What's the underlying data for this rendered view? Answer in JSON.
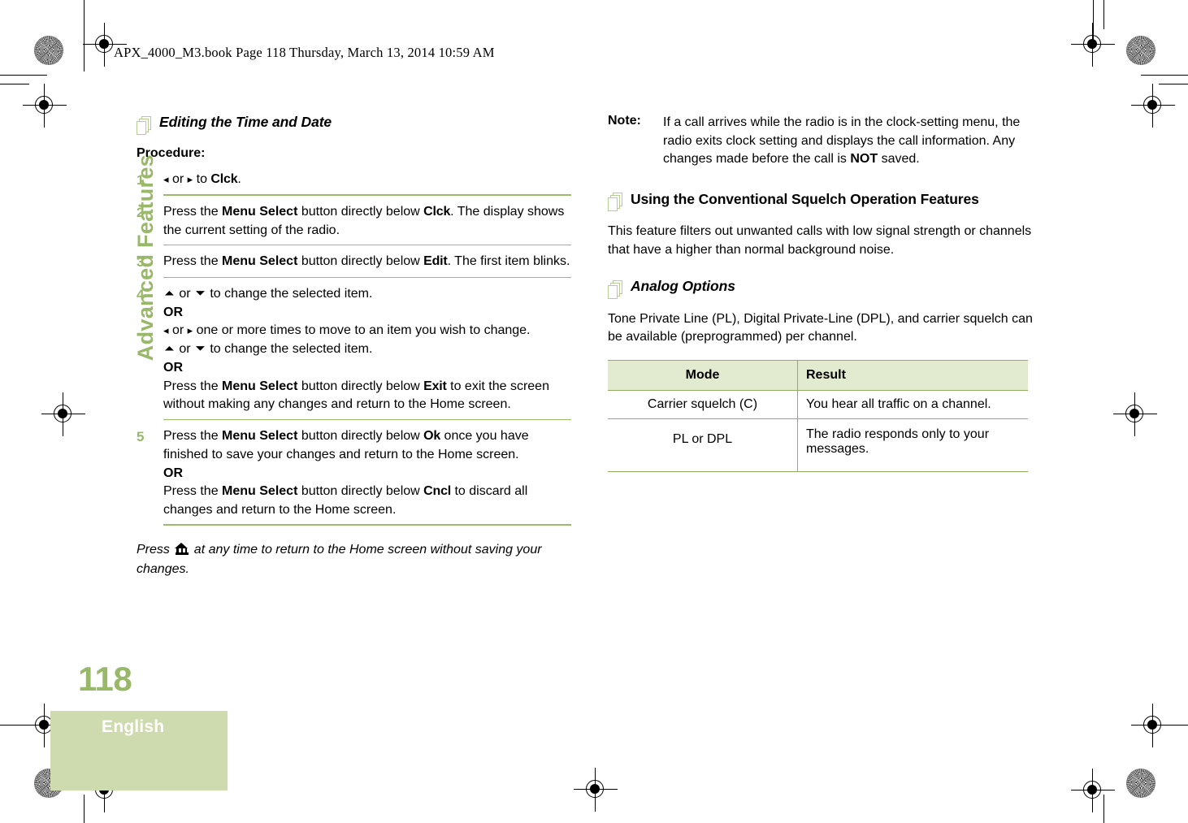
{
  "running_head": "APX_4000_M3.book  Page 118  Thursday, March 13, 2014  10:59 AM",
  "sidebar": {
    "chapter_tab": "Advanced Features",
    "page_number": "118",
    "language": "English"
  },
  "left_column": {
    "section_title": "Editing the Time and Date",
    "procedure_label": "Procedure:",
    "steps": [
      {
        "number": "1",
        "parts": [
          {
            "type": "arrow-left"
          },
          {
            "type": "text",
            "value": " or "
          },
          {
            "type": "arrow-right"
          },
          {
            "type": "text",
            "value": " to "
          },
          {
            "type": "keyword",
            "value": "Clck"
          },
          {
            "type": "text",
            "value": "."
          }
        ]
      },
      {
        "number": "2",
        "parts": [
          {
            "type": "text",
            "value": "Press the "
          },
          {
            "type": "bold",
            "value": "Menu Select"
          },
          {
            "type": "text",
            "value": " button directly below "
          },
          {
            "type": "keyword",
            "value": "Clck"
          },
          {
            "type": "text",
            "value": ". The display shows the current setting of the radio."
          }
        ]
      },
      {
        "number": "3",
        "parts": [
          {
            "type": "text",
            "value": "Press the "
          },
          {
            "type": "bold",
            "value": "Menu Select"
          },
          {
            "type": "text",
            "value": " button directly below "
          },
          {
            "type": "keyword",
            "value": "Edit"
          },
          {
            "type": "text",
            "value": ". The first item blinks."
          }
        ]
      },
      {
        "number": "4",
        "parts": [
          {
            "type": "arrow-up"
          },
          {
            "type": "text",
            "value": " or "
          },
          {
            "type": "arrow-down"
          },
          {
            "type": "text",
            "value": " to change the selected item."
          },
          {
            "type": "break"
          },
          {
            "type": "bold",
            "value": "OR"
          },
          {
            "type": "break"
          },
          {
            "type": "arrow-left"
          },
          {
            "type": "text",
            "value": " or "
          },
          {
            "type": "arrow-right"
          },
          {
            "type": "text",
            "value": " one or more times to move to an item you wish to change."
          },
          {
            "type": "break"
          },
          {
            "type": "arrow-up"
          },
          {
            "type": "text",
            "value": " or "
          },
          {
            "type": "arrow-down"
          },
          {
            "type": "text",
            "value": " to change the selected item."
          },
          {
            "type": "break"
          },
          {
            "type": "bold",
            "value": "OR"
          },
          {
            "type": "break"
          },
          {
            "type": "text",
            "value": "Press the "
          },
          {
            "type": "bold",
            "value": "Menu Select"
          },
          {
            "type": "text",
            "value": " button directly below "
          },
          {
            "type": "keyword",
            "value": "Exit"
          },
          {
            "type": "text",
            "value": " to exit the screen without making any changes and return to the Home screen."
          }
        ]
      },
      {
        "number": "5",
        "parts": [
          {
            "type": "text",
            "value": "Press the "
          },
          {
            "type": "bold",
            "value": "Menu Select"
          },
          {
            "type": "text",
            "value": " button directly below "
          },
          {
            "type": "keyword",
            "value": "Ok"
          },
          {
            "type": "text",
            "value": " once you have finished to save your changes and return to the Home screen."
          },
          {
            "type": "break"
          },
          {
            "type": "bold",
            "value": "OR"
          },
          {
            "type": "break"
          },
          {
            "type": "text",
            "value": "Press the "
          },
          {
            "type": "bold",
            "value": "Menu Select"
          },
          {
            "type": "text",
            "value": " button directly below "
          },
          {
            "type": "keyword",
            "value": "Cncl"
          },
          {
            "type": "text",
            "value": " to discard all changes and return to the Home screen."
          }
        ]
      }
    ],
    "closing_note": {
      "before_icon": "Press ",
      "after_icon": " at any time to return to the Home screen without saving your changes."
    }
  },
  "right_column": {
    "note": {
      "label": "Note:",
      "parts": [
        {
          "type": "text",
          "value": "If a call arrives while the radio is in the clock-setting menu, the radio exits clock setting and displays the call information. Any changes made before the call is "
        },
        {
          "type": "bold",
          "value": "NOT"
        },
        {
          "type": "text",
          "value": " saved."
        }
      ]
    },
    "squelch_section": {
      "title": "Using the Conventional Squelch Operation Features",
      "body": "This feature filters out unwanted calls with low signal strength or channels that have a higher than normal background noise."
    },
    "analog_section": {
      "title": "Analog Options",
      "body": "Tone Private Line (PL), Digital Private-Line (DPL), and carrier squelch can be available (preprogrammed) per channel."
    },
    "table": {
      "headers": [
        "Mode",
        "Result"
      ],
      "rows": [
        [
          "Carrier squelch (C)",
          "You hear all traffic on a channel."
        ],
        [
          "PL or DPL",
          "The radio responds only to your messages."
        ]
      ]
    }
  },
  "icons": {
    "pages": "pages-stack-icon",
    "home": "home-icon",
    "arrow_left": "◂",
    "arrow_right": "▸",
    "arrow_up": "▲",
    "arrow_down": "▼"
  },
  "colors": {
    "accent_green": "#99b869",
    "rule_green": "#8fae63",
    "table_header_fill": "#e2ebd0",
    "language_block_fill": "#cddbae",
    "icon_outline": "#b6ce92"
  }
}
